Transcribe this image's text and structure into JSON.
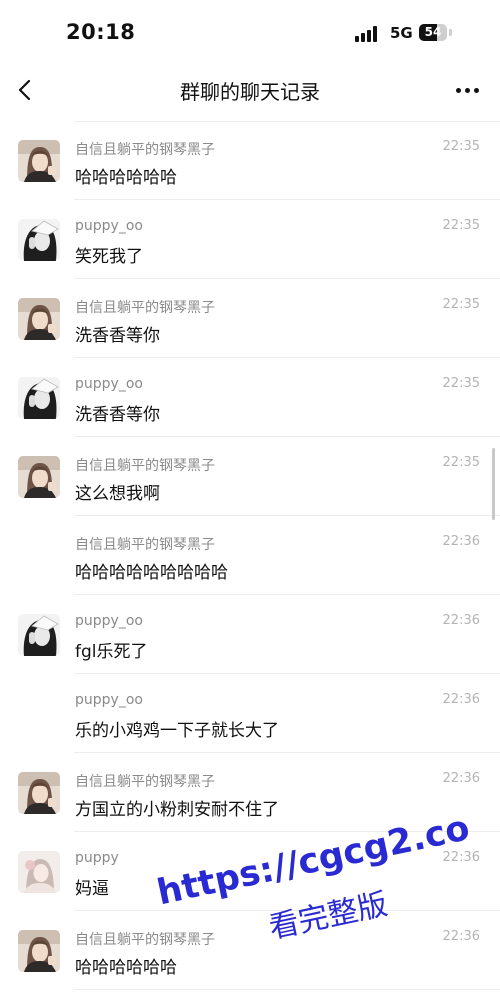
{
  "status_bar": {
    "time": "20:18",
    "network": "5G",
    "battery": "54"
  },
  "header": {
    "title": "群聊的聊天记录"
  },
  "messages": [
    {
      "sender": "自信且躺平的钢琴黑子",
      "time": "22:35",
      "text": "哈哈哈哈哈哈",
      "avatar": "girl-photo"
    },
    {
      "sender": "puppy_oo",
      "time": "22:35",
      "text": "笑死我了",
      "avatar": "bw-photo"
    },
    {
      "sender": "自信且躺平的钢琴黑子",
      "time": "22:35",
      "text": "洗香香等你",
      "avatar": "girl-photo"
    },
    {
      "sender": "puppy_oo",
      "time": "22:35",
      "text": "洗香香等你",
      "avatar": "bw-photo"
    },
    {
      "sender": "自信且躺平的钢琴黑子",
      "time": "22:35",
      "text": "这么想我啊",
      "avatar": "girl-photo"
    },
    {
      "sender": "自信且躺平的钢琴黑子",
      "time": "22:36",
      "text": "哈哈哈哈哈哈哈哈哈",
      "avatar": "none"
    },
    {
      "sender": "puppy_oo",
      "time": "22:36",
      "text": "fgl乐死了",
      "avatar": "bw-photo"
    },
    {
      "sender": "puppy_oo",
      "time": "22:36",
      "text": "乐的小鸡鸡一下子就长大了",
      "avatar": "none"
    },
    {
      "sender": "自信且躺平的钢琴黑子",
      "time": "22:36",
      "text": "方国立的小粉刺安耐不住了",
      "avatar": "girl-photo"
    },
    {
      "sender": "puppy",
      "time": "22:36",
      "text": "妈逼",
      "avatar": "soft-photo"
    },
    {
      "sender": "自信且躺平的钢琴黑子",
      "time": "22:36",
      "text": "哈哈哈哈哈哈",
      "avatar": "girl-photo"
    }
  ],
  "watermark": {
    "url": "https://cgcg2.co",
    "caption": "看完整版"
  },
  "colors": {
    "text": "#111111",
    "meta": "#8a8a8a",
    "time": "#b4b4b4",
    "divider": "#ededed",
    "watermark": "#2a2ad2"
  }
}
